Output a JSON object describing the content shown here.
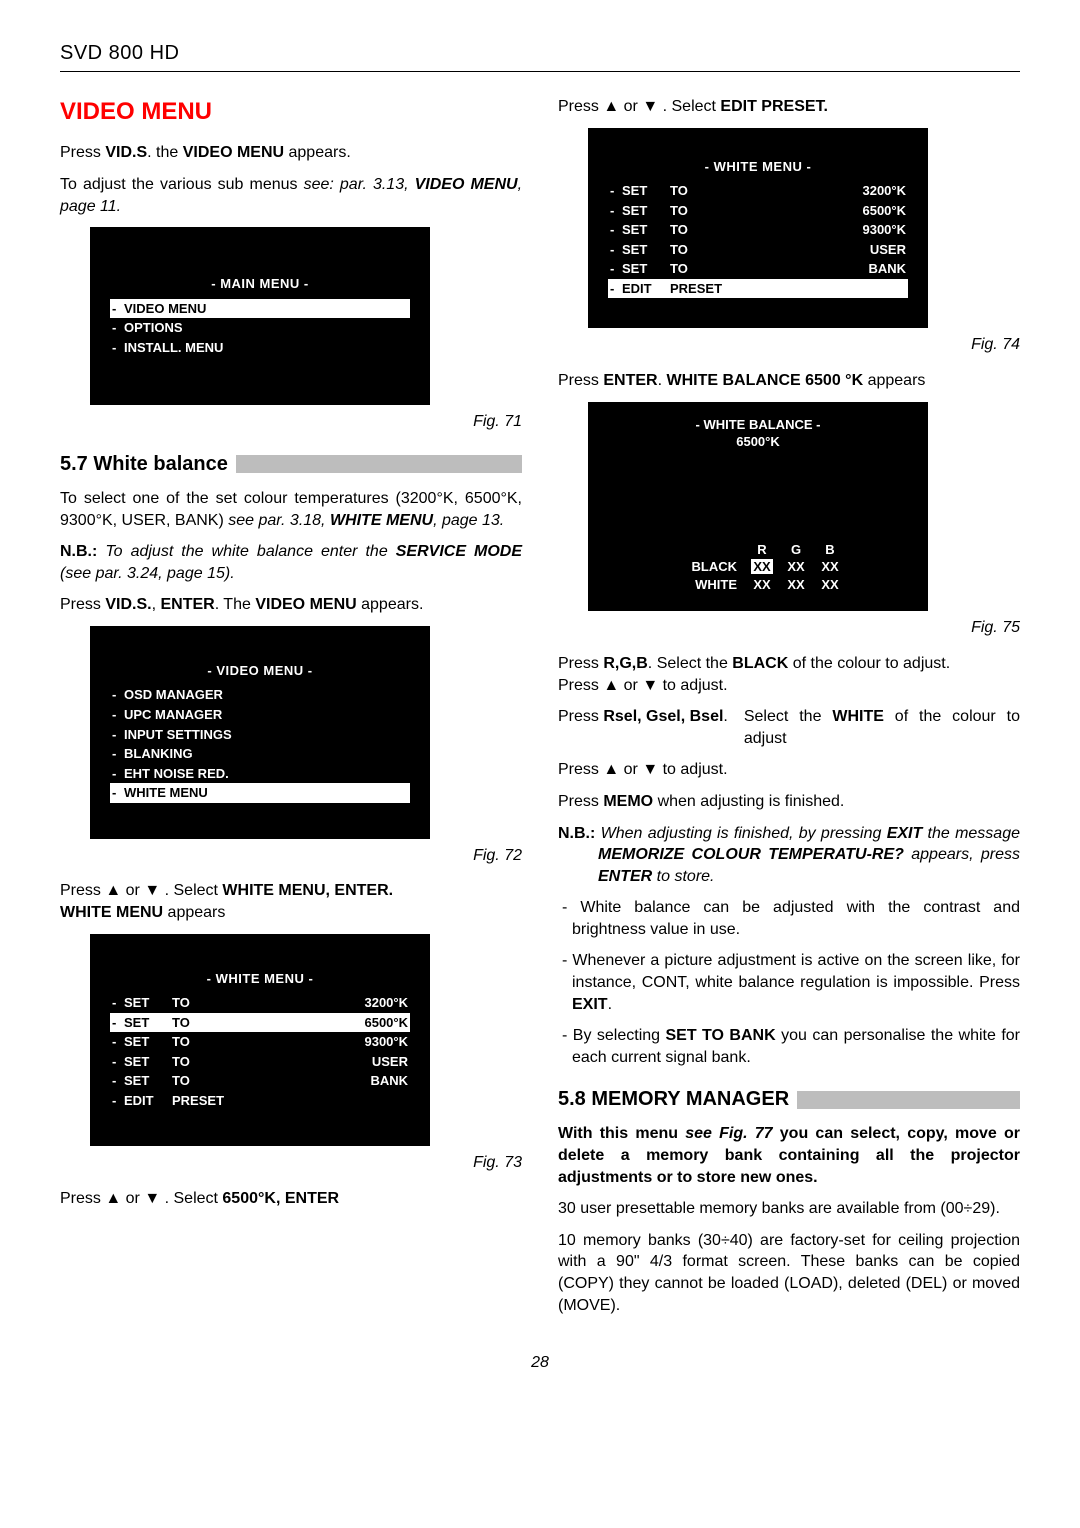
{
  "model": "SVD 800 HD",
  "left": {
    "h_video_menu": "VIDEO MENU",
    "p1a": "Press ",
    "p1b": "VID.S",
    "p1c": ". the ",
    "p1d": "VIDEO MENU",
    "p1e": " appears.",
    "p2a": "To adjust the various sub menus ",
    "p2b": "see: par. 3.13, ",
    "p2c": "VIDEO MENU",
    "p2d": ", page 11.",
    "screen1": {
      "title": "- MAIN MENU -",
      "rows": [
        {
          "d": "-",
          "text": "VIDEO MENU",
          "sel": true
        },
        {
          "d": "-",
          "text": "OPTIONS"
        },
        {
          "d": "-",
          "text": "INSTALL. MENU"
        }
      ]
    },
    "fig71": "Fig. 71",
    "h_57": "5.7 White balance",
    "p3a": "To select one of the set colour temperatures (3200°K, 6500°K, 9300°K, USER, BANK) ",
    "p3b": "see par. 3.18, ",
    "p3c": "WHITE MENU",
    "p3d": ", page 13.",
    "p4a": "N.B.:",
    "p4b": " To adjust the white balance enter the ",
    "p4c": "SERVICE MODE",
    "p4d": " (see par. 3.24, page 15).",
    "p5a": "Press ",
    "p5b": "VID.S.",
    "p5c": ", ",
    "p5d": "ENTER",
    "p5e": ". The ",
    "p5f": "VIDEO MENU",
    "p5g": " appears.",
    "screen2": {
      "title": "- VIDEO MENU -",
      "rows": [
        {
          "d": "-",
          "text": "OSD MANAGER"
        },
        {
          "d": "-",
          "text": "UPC MANAGER"
        },
        {
          "d": "-",
          "text": "INPUT SETTINGS"
        },
        {
          "d": "-",
          "text": "BLANKING"
        },
        {
          "d": "-",
          "text": "EHT NOISE RED."
        },
        {
          "d": "-",
          "text": "WHITE MENU",
          "sel": true
        }
      ]
    },
    "fig72": "Fig. 72",
    "p6a": "Press ",
    "p6b": " or ",
    "p6c": " . Select ",
    "p6d": "WHITE MENU, ENTER.",
    "p6e": "WHITE MENU",
    "p6f": " appears",
    "screen3": {
      "title": "- WHITE MENU -",
      "rows": [
        {
          "d": "-",
          "c1": "SET",
          "c2": "TO",
          "c3": "3200°K"
        },
        {
          "d": "-",
          "c1": "SET",
          "c2": "TO",
          "c3": "6500°K",
          "sel": true
        },
        {
          "d": "-",
          "c1": "SET",
          "c2": "TO",
          "c3": "9300°K"
        },
        {
          "d": "-",
          "c1": "SET",
          "c2": "TO",
          "c3": "USER"
        },
        {
          "d": "-",
          "c1": "SET",
          "c2": "TO",
          "c3": "BANK"
        },
        {
          "d": "-",
          "c1": "EDIT",
          "c2": "PRESET",
          "c3": ""
        }
      ]
    },
    "fig73": "Fig. 73",
    "p7a": "Press ",
    "p7b": " or ",
    "p7c": " . Select ",
    "p7d": "6500°K, ENTER"
  },
  "right": {
    "p1a": "Press ",
    "p1b": " or ",
    "p1c": " . Select ",
    "p1d": "EDIT PRESET.",
    "screen4": {
      "title": "- WHITE MENU -",
      "rows": [
        {
          "d": "-",
          "c1": "SET",
          "c2": "TO",
          "c3": "3200°K"
        },
        {
          "d": "-",
          "c1": "SET",
          "c2": "TO",
          "c3": "6500°K"
        },
        {
          "d": "-",
          "c1": "SET",
          "c2": "TO",
          "c3": "9300°K"
        },
        {
          "d": "-",
          "c1": "SET",
          "c2": "TO",
          "c3": "USER"
        },
        {
          "d": "-",
          "c1": "SET",
          "c2": "TO",
          "c3": "BANK"
        },
        {
          "d": "-",
          "c1": "EDIT",
          "c2": "PRESET",
          "c3": "",
          "sel": true
        }
      ]
    },
    "fig74": "Fig. 74",
    "p2a": "Press ",
    "p2b": "ENTER",
    "p2c": ". ",
    "p2d": "WHITE BALANCE 6500 °K",
    "p2e": " appears",
    "wb": {
      "title1": "- WHITE BALANCE -",
      "title2": "6500°K",
      "cols": [
        "R",
        "G",
        "B"
      ],
      "black_label": "BLACK",
      "white_label": "WHITE",
      "black": [
        "XX",
        "XX",
        "XX"
      ],
      "white": [
        "XX",
        "XX",
        "XX"
      ]
    },
    "fig75": "Fig. 75",
    "p3a": "Press ",
    "p3b": "R,G,B",
    "p3c": ". Select the ",
    "p3d": "BLACK",
    "p3e": " of the colour to adjust.",
    "p3f": "Press ",
    "p3g": " or ",
    "p3h": " to adjust.",
    "p4a": "Press ",
    "p4b": "Rsel, Gsel, Bsel",
    "p4c": ".",
    "p4d": "Select the ",
    "p4e": "WHITE",
    "p4f": " of the colour to adjust",
    "p5a": "Press ",
    "p5b": " or ",
    "p5c": " to adjust.",
    "p6a": "Press ",
    "p6b": "MEMO",
    "p6c": " when adjusting is finished.",
    "p7a": "N.B.:",
    "p7b": " When adjusting is finished, by pressing  ",
    "p7c": "EXIT",
    "p7d": " the message ",
    "p7e": "MEMORIZE COLOUR TEMPERATU-RE?",
    "p7f": " appears, press ",
    "p7g": "ENTER",
    "p7h": " to store.",
    "b1": "-  White balance can be adjusted with the contrast and brightness value in use.",
    "b2a": "-  Whenever a picture adjustment is active on the screen like, for instance, CONT, white balance regulation is impossible. Press  ",
    "b2b": "EXIT",
    "b2c": ".",
    "b3a": "-  By selecting ",
    "b3b": "SET TO BANK",
    "b3c": " you can personalise the white for each current signal bank.",
    "h_58": "5.8 MEMORY MANAGER",
    "p8a": "With this menu ",
    "p8b": "see Fig. 77",
    "p8c": " you can select, copy, move or delete a memory bank containing all the projector adjustments or to store new ones.",
    "p9": "30 user presettable memory banks are available from (00÷29).",
    "p10": "10 memory banks (30÷40) are factory-set for ceiling projection with a 90\" 4/3 format screen. These banks can be copied (COPY) they cannot be loaded (LOAD), deleted (DEL) or moved (MOVE)."
  },
  "page_num": "28",
  "glyph": {
    "up": "▲",
    "down": "▼"
  }
}
